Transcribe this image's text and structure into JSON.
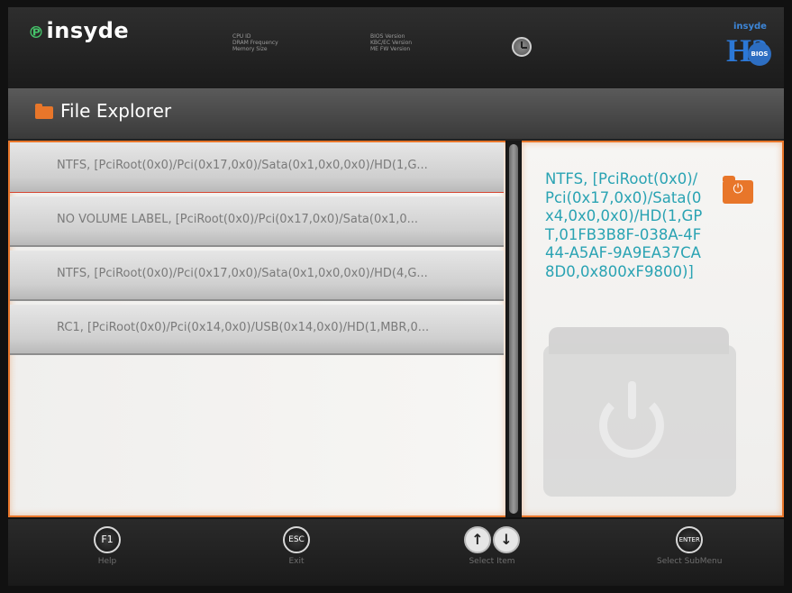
{
  "header": {
    "logo_text": "insyde",
    "logo_mark": "℗",
    "sysinfo_left": [
      "CPU ID",
      "DRAM Frequency",
      "Memory Size"
    ],
    "sysinfo_right": [
      "BIOS Version",
      "KBC/EC Version",
      "ME FW Version"
    ],
    "clock_icon": "clock-icon",
    "badge_small_text": "insyde",
    "badge_h2": "H2",
    "badge_bios": "BIOS"
  },
  "titlebar": {
    "icon": "folder-icon",
    "title": "File Explorer"
  },
  "file_list": {
    "items": [
      {
        "label": "NTFS, [PciRoot(0x0)/Pci(0x17,0x0)/Sata(0x1,0x0,0x0)/HD(1,G..."
      },
      {
        "label": "NO VOLUME LABEL, [PciRoot(0x0)/Pci(0x17,0x0)/Sata(0x1,0..."
      },
      {
        "label": "NTFS, [PciRoot(0x0)/Pci(0x17,0x0)/Sata(0x1,0x0,0x0)/HD(4,G..."
      },
      {
        "label": "RC1, [PciRoot(0x0)/Pci(0x14,0x0)/USB(0x14,0x0)/HD(1,MBR,0..."
      }
    ],
    "selected_index": 0
  },
  "detail": {
    "text": "NTFS, [PciRoot(0x0)/Pci(0x17,0x0)/Sata(0x4,0x0,0x0)/HD(1,GPT,01FB3B8F-038A-4F44-A5AF-9A9EA37CA8D0,0x800xF9800)]",
    "icon": "power-folder-icon",
    "power_glyph": "⏻"
  },
  "footer": {
    "keys": [
      {
        "key": "F1",
        "label": "Help"
      },
      {
        "key": "ESC",
        "label": "Exit"
      },
      {
        "key_up": "↑",
        "key_down": "↓",
        "label": "Select Item"
      },
      {
        "key": "ENTER",
        "label": "Select  SubMenu"
      }
    ]
  },
  "colors": {
    "accent": "#e8762a",
    "detail_text": "#2aa3b3",
    "header_bg": "#252525",
    "list_text": "#7a7a7a"
  }
}
